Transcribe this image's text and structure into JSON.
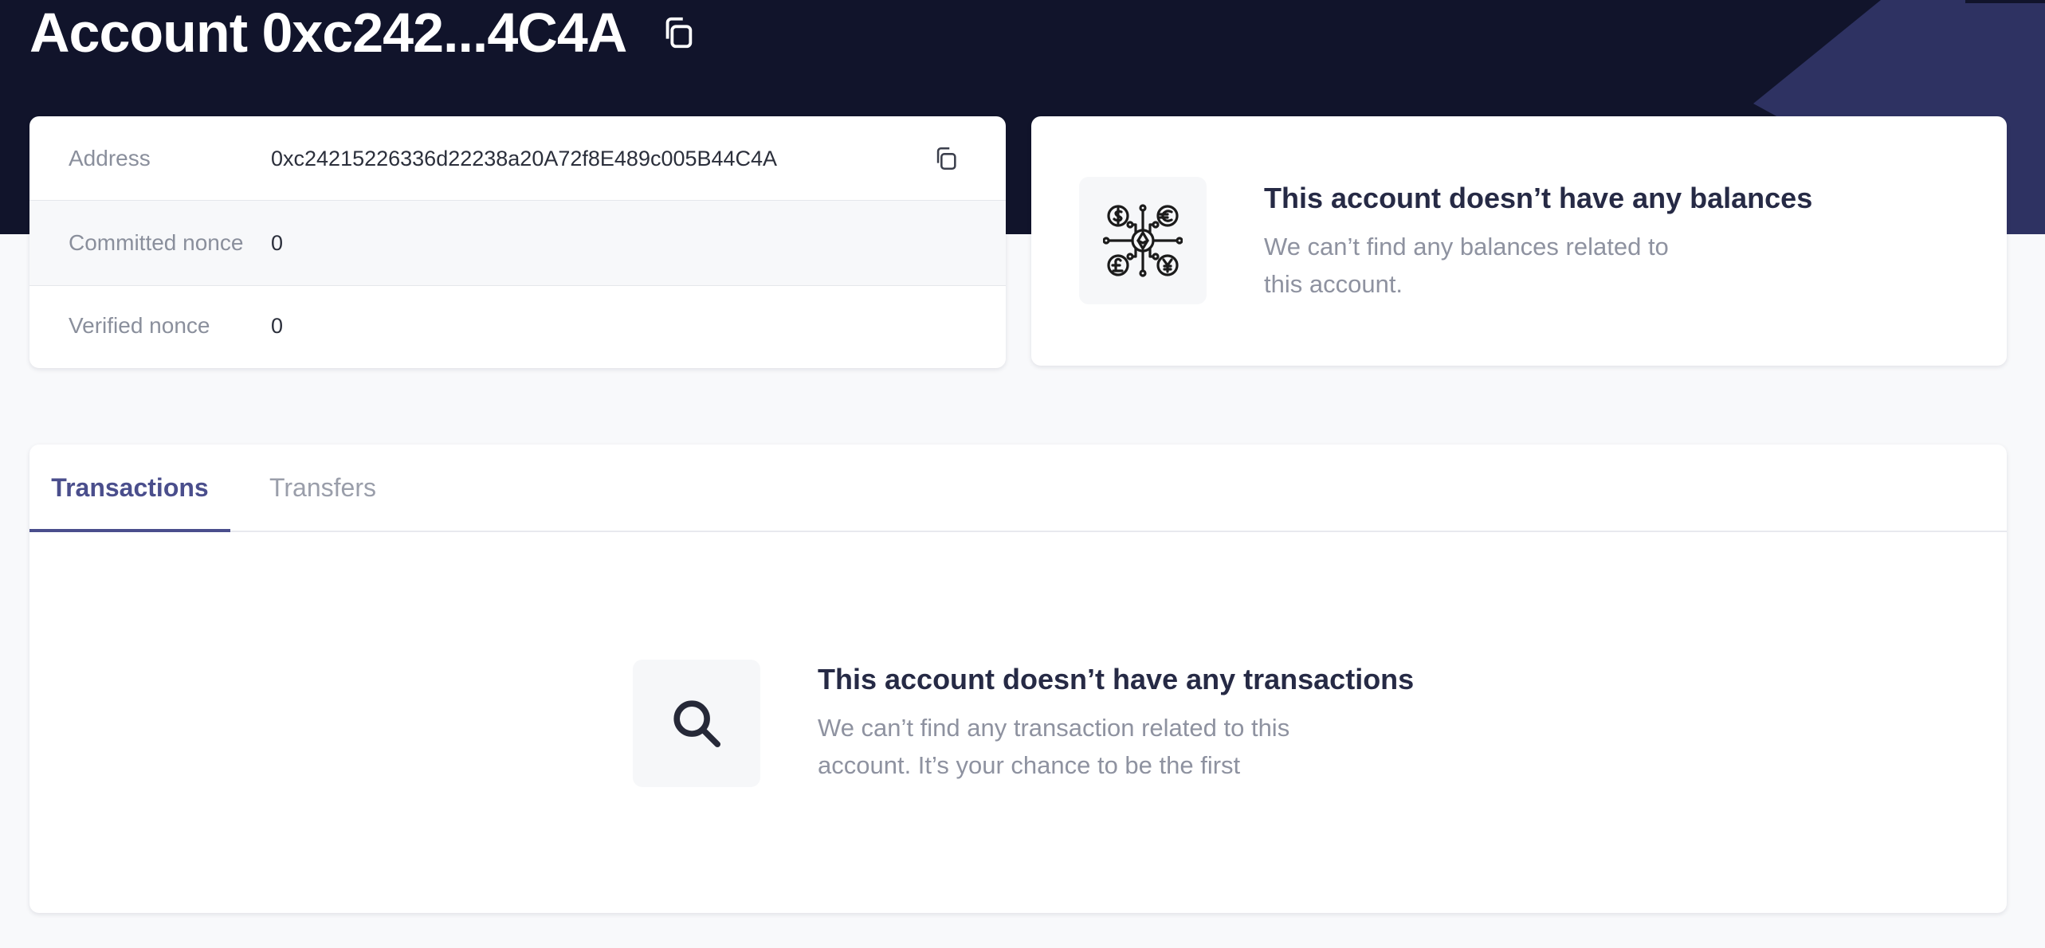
{
  "header": {
    "title": "Account 0xc242...4C4A",
    "copy_icon": "copy-icon"
  },
  "account_info": {
    "rows": [
      {
        "label": "Address",
        "value": "0xc24215226336d22238a20A72f8E489c005B44C4A",
        "action_icon": "copy-icon"
      },
      {
        "label": "Committed nonce",
        "value": "0"
      },
      {
        "label": "Verified nonce",
        "value": "0"
      }
    ]
  },
  "balances": {
    "icon": "currency-network-icon",
    "empty_title": "This account doesn’t have any balances",
    "empty_description": "We can’t find any balances related to this account."
  },
  "tabs": {
    "items": [
      {
        "label": "Transactions",
        "active": true
      },
      {
        "label": "Transfers",
        "active": false
      }
    ]
  },
  "transactions": {
    "icon": "search-icon",
    "empty_title": "This account doesn’t have any transactions",
    "empty_description": "We can’t find any transaction related to this account. It’s your chance to be the first"
  },
  "colors": {
    "header_bg": "#11142b",
    "header_accent": "#2e3262",
    "page_bg": "#f8f9fb",
    "tab_active": "#4a4e8c",
    "muted_text": "#8e92a0",
    "title_text": "#262a45"
  }
}
